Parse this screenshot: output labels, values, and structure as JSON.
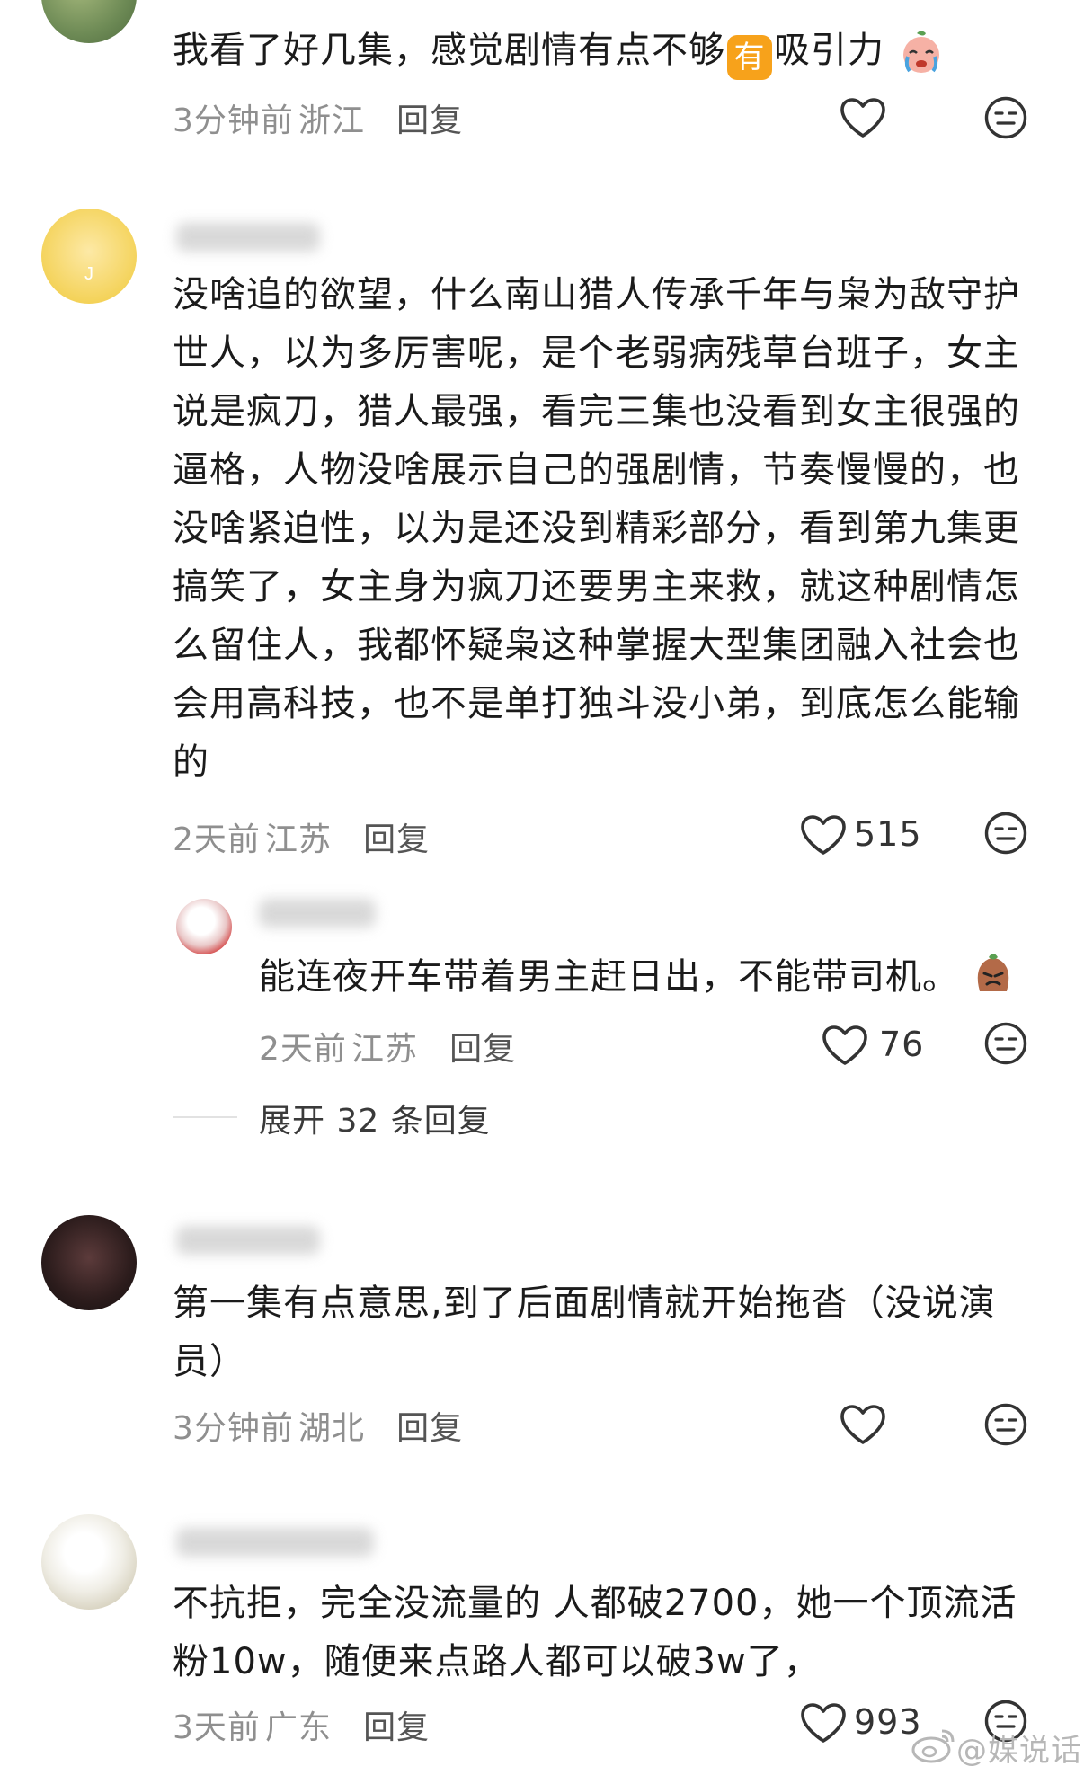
{
  "comments": [
    {
      "text_before_badge": "我看了好几集，感觉剧情有点不够",
      "badge": "有",
      "text_after_badge": "吸引力",
      "time": "3分钟前",
      "location": "浙江",
      "reply_label": "回复",
      "like_count": ""
    },
    {
      "text": "没啥追的欲望，什么南山猎人传承千年与枭为敌守护世人，以为多厉害呢，是个老弱病残草台班子，女主说是疯刀，猎人最强，看完三集也没看到女主很强的逼格，人物没啥展示自己的强剧情，节奏慢慢的，也没啥紧迫性，以为是还没到精彩部分，看到第九集更搞笑了，女主身为疯刀还要男主来救，就这种剧情怎么留住人，我都怀疑枭这种掌握大型集团融入社会也会用高科技，也不是单打独斗没小弟，到底怎么能输的",
      "time": "2天前",
      "location": "江苏",
      "reply_label": "回复",
      "like_count": "515",
      "sub_reply": {
        "text": "能连夜开车带着男主赶日出，不能带司机。",
        "time": "2天前",
        "location": "江苏",
        "reply_label": "回复",
        "like_count": "76"
      },
      "expand_label": "展开 32 条回复"
    },
    {
      "text": "第一集有点意思,到了后面剧情就开始拖沓（没说演员）",
      "time": "3分钟前",
      "location": "湖北",
      "reply_label": "回复",
      "like_count": ""
    },
    {
      "text": "不抗拒，完全没流量的 人都破2700，她一个顶流活粉10w，随便来点路人都可以破3w了，",
      "time": "3天前",
      "location": "广东",
      "reply_label": "回复",
      "like_count": "993"
    }
  ],
  "watermark": "@媒说话",
  "icons": [
    "heart-icon",
    "sticker-face-icon",
    "weibo-logo-icon"
  ]
}
